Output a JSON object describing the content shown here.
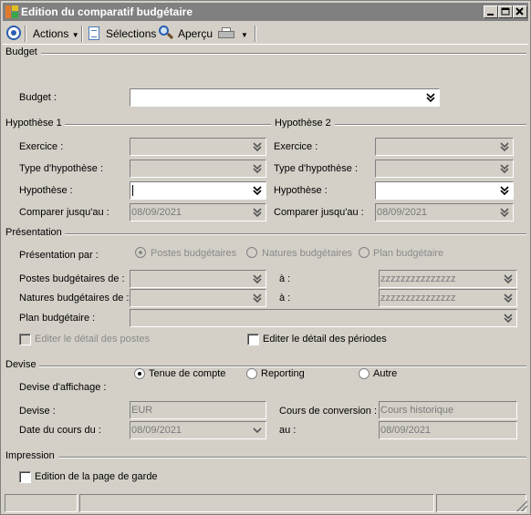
{
  "window": {
    "title": "Edition du comparatif budgétaire"
  },
  "toolbar": {
    "actions_label": "Actions",
    "selections_label": "Sélections",
    "preview_label": "Aperçu"
  },
  "budget": {
    "section_title": "Budget",
    "budget_label": "Budget :",
    "budget_value": ""
  },
  "hypothese1": {
    "section_title": "Hypothèse 1",
    "exercice_label": "Exercice :",
    "type_label": "Type d'hypothèse :",
    "hypothese_label": "Hypothèse :",
    "compare_label": "Comparer jusqu'au :",
    "compare_value": "08/09/2021"
  },
  "hypothese2": {
    "section_title": "Hypothèse 2",
    "exercice_label": "Exercice :",
    "type_label": "Type d'hypothèse :",
    "hypothese_label": "Hypothèse :",
    "compare_label": "Comparer jusqu'au :",
    "compare_value": "08/09/2021"
  },
  "presentation": {
    "section_title": "Présentation",
    "par_label": "Présentation par :",
    "options": [
      "Postes budgétaires",
      "Natures budgétaires",
      "Plan budgétaire"
    ],
    "selected": "Postes budgétaires",
    "postes_de_label": "Postes budgétaires de :",
    "natures_de_label": "Natures budgétaires de :",
    "plan_label": "Plan budgétaire :",
    "a_label": "à :",
    "postes_to_value": "zzzzzzzzzzzzzzz",
    "natures_to_value": "zzzzzzzzzzzzzzz",
    "detail_postes_label": "Editer le détail des postes",
    "detail_periodes_label": "Editer le détail des périodes"
  },
  "devise": {
    "section_title": "Devise",
    "affichage_label": "Devise d'affichage :",
    "options": [
      "Tenue de compte",
      "Reporting",
      "Autre"
    ],
    "selected": "Tenue de compte",
    "devise_label": "Devise :",
    "devise_value": "EUR",
    "cours_label": "Cours de conversion :",
    "cours_value": "Cours historique",
    "date_label": "Date du cours du :",
    "date_value": "08/09/2021",
    "au_label": "au :",
    "au_value": "08/09/2021"
  },
  "impression": {
    "section_title": "Impression",
    "page_garde_label": "Edition de la page de garde"
  },
  "colors": {
    "window_bg": "#d4d0c8",
    "titlebar": "#808080",
    "accent": "#2a5db0"
  }
}
